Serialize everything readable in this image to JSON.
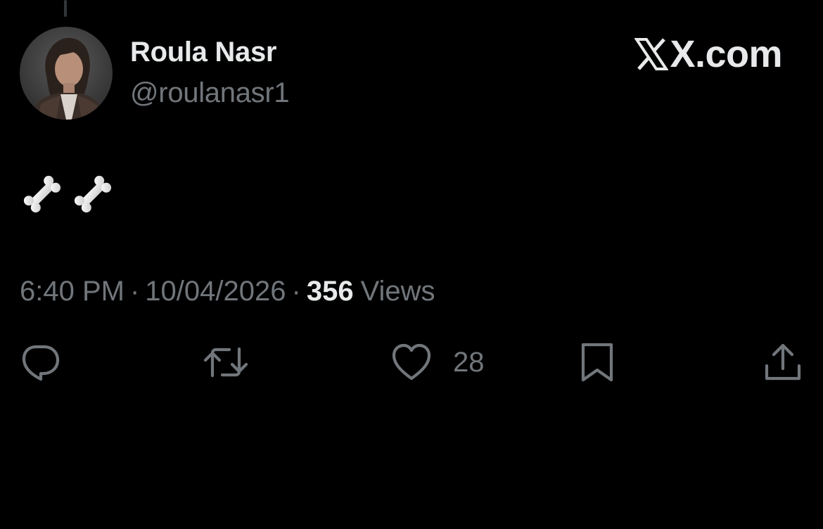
{
  "author": {
    "name": "Roula Nasr",
    "handle": "@roulanasr1"
  },
  "brand": {
    "text": "X.com",
    "icon": "x-logo-icon"
  },
  "tweet": {
    "body_icons": [
      "bone-icon",
      "bone-icon"
    ],
    "time": "6:40 PM",
    "date": "10/04/2026",
    "separator": "·",
    "views_count": "356",
    "views_label": "Views"
  },
  "actions": {
    "reply": {
      "icon": "reply-icon"
    },
    "retweet": {
      "icon": "retweet-icon"
    },
    "like": {
      "icon": "heart-icon",
      "count": "28"
    },
    "bookmark": {
      "icon": "bookmark-icon"
    },
    "share": {
      "icon": "share-icon"
    }
  },
  "colors": {
    "background": "#000000",
    "primary_text": "#e7e9ea",
    "secondary_text": "#71767b"
  }
}
